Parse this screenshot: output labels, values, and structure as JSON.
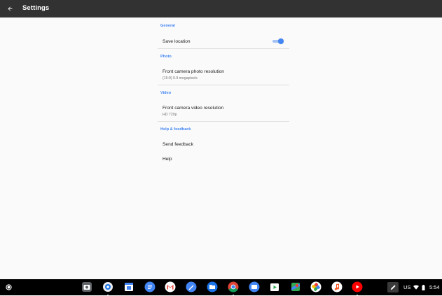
{
  "appbar": {
    "title": "Settings",
    "back_icon": "arrow-back-icon"
  },
  "sections": {
    "general": {
      "header": "General",
      "save_location": {
        "label": "Save location",
        "enabled": true
      }
    },
    "photo": {
      "header": "Photo",
      "front_camera": {
        "title": "Front camera photo resolution",
        "value": "(16:9) 0.9 megapixels"
      }
    },
    "video": {
      "header": "Video",
      "front_camera": {
        "title": "Front camera video resolution",
        "value": "HD 720p"
      }
    },
    "help": {
      "header": "Help & feedback",
      "send_feedback": "Send feedback",
      "help": "Help"
    }
  },
  "colors": {
    "accent": "#4285f4",
    "appbar": "#323232",
    "background": "#fafafa"
  },
  "shelf": {
    "apps": [
      "camera-icon",
      "chrome-camera-icon",
      "calendar-icon",
      "docs-icon",
      "gmail-icon",
      "pen-app-icon",
      "files-icon",
      "chrome-icon",
      "messages-icon",
      "play-store-icon",
      "maps-icon",
      "photos-icon",
      "music-icon",
      "youtube-icon"
    ],
    "status": {
      "keyboard": "US",
      "time": "5:54"
    }
  }
}
